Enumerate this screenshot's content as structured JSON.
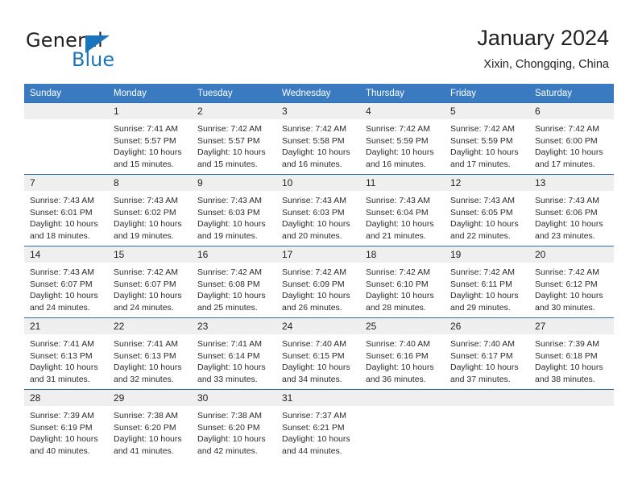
{
  "brand": {
    "name_top": "General",
    "name_bottom": "Blue",
    "accent_color": "#1b75bc"
  },
  "header": {
    "title": "January 2024",
    "subtitle": "Xixin, Chongqing, China"
  },
  "colors": {
    "header_row_bg": "#3a7ac0",
    "header_row_text": "#ffffff",
    "daynum_bg": "#efefef",
    "row_divider": "#2e6da8",
    "cell_bg": "#ffffff"
  },
  "calendar": {
    "weekday_headers": [
      "Sunday",
      "Monday",
      "Tuesday",
      "Wednesday",
      "Thursday",
      "Friday",
      "Saturday"
    ],
    "labels": {
      "sunrise_prefix": "Sunrise:",
      "sunset_prefix": "Sunset:",
      "daylight_prefix": "Daylight:"
    },
    "weeks": [
      [
        {
          "day": "",
          "lines": [
            "",
            "",
            "",
            ""
          ]
        },
        {
          "day": "1",
          "lines": [
            "Sunrise: 7:41 AM",
            "Sunset: 5:57 PM",
            "Daylight: 10 hours",
            "and 15 minutes."
          ]
        },
        {
          "day": "2",
          "lines": [
            "Sunrise: 7:42 AM",
            "Sunset: 5:57 PM",
            "Daylight: 10 hours",
            "and 15 minutes."
          ]
        },
        {
          "day": "3",
          "lines": [
            "Sunrise: 7:42 AM",
            "Sunset: 5:58 PM",
            "Daylight: 10 hours",
            "and 16 minutes."
          ]
        },
        {
          "day": "4",
          "lines": [
            "Sunrise: 7:42 AM",
            "Sunset: 5:59 PM",
            "Daylight: 10 hours",
            "and 16 minutes."
          ]
        },
        {
          "day": "5",
          "lines": [
            "Sunrise: 7:42 AM",
            "Sunset: 5:59 PM",
            "Daylight: 10 hours",
            "and 17 minutes."
          ]
        },
        {
          "day": "6",
          "lines": [
            "Sunrise: 7:42 AM",
            "Sunset: 6:00 PM",
            "Daylight: 10 hours",
            "and 17 minutes."
          ]
        }
      ],
      [
        {
          "day": "7",
          "lines": [
            "Sunrise: 7:43 AM",
            "Sunset: 6:01 PM",
            "Daylight: 10 hours",
            "and 18 minutes."
          ]
        },
        {
          "day": "8",
          "lines": [
            "Sunrise: 7:43 AM",
            "Sunset: 6:02 PM",
            "Daylight: 10 hours",
            "and 19 minutes."
          ]
        },
        {
          "day": "9",
          "lines": [
            "Sunrise: 7:43 AM",
            "Sunset: 6:03 PM",
            "Daylight: 10 hours",
            "and 19 minutes."
          ]
        },
        {
          "day": "10",
          "lines": [
            "Sunrise: 7:43 AM",
            "Sunset: 6:03 PM",
            "Daylight: 10 hours",
            "and 20 minutes."
          ]
        },
        {
          "day": "11",
          "lines": [
            "Sunrise: 7:43 AM",
            "Sunset: 6:04 PM",
            "Daylight: 10 hours",
            "and 21 minutes."
          ]
        },
        {
          "day": "12",
          "lines": [
            "Sunrise: 7:43 AM",
            "Sunset: 6:05 PM",
            "Daylight: 10 hours",
            "and 22 minutes."
          ]
        },
        {
          "day": "13",
          "lines": [
            "Sunrise: 7:43 AM",
            "Sunset: 6:06 PM",
            "Daylight: 10 hours",
            "and 23 minutes."
          ]
        }
      ],
      [
        {
          "day": "14",
          "lines": [
            "Sunrise: 7:43 AM",
            "Sunset: 6:07 PM",
            "Daylight: 10 hours",
            "and 24 minutes."
          ]
        },
        {
          "day": "15",
          "lines": [
            "Sunrise: 7:42 AM",
            "Sunset: 6:07 PM",
            "Daylight: 10 hours",
            "and 24 minutes."
          ]
        },
        {
          "day": "16",
          "lines": [
            "Sunrise: 7:42 AM",
            "Sunset: 6:08 PM",
            "Daylight: 10 hours",
            "and 25 minutes."
          ]
        },
        {
          "day": "17",
          "lines": [
            "Sunrise: 7:42 AM",
            "Sunset: 6:09 PM",
            "Daylight: 10 hours",
            "and 26 minutes."
          ]
        },
        {
          "day": "18",
          "lines": [
            "Sunrise: 7:42 AM",
            "Sunset: 6:10 PM",
            "Daylight: 10 hours",
            "and 28 minutes."
          ]
        },
        {
          "day": "19",
          "lines": [
            "Sunrise: 7:42 AM",
            "Sunset: 6:11 PM",
            "Daylight: 10 hours",
            "and 29 minutes."
          ]
        },
        {
          "day": "20",
          "lines": [
            "Sunrise: 7:42 AM",
            "Sunset: 6:12 PM",
            "Daylight: 10 hours",
            "and 30 minutes."
          ]
        }
      ],
      [
        {
          "day": "21",
          "lines": [
            "Sunrise: 7:41 AM",
            "Sunset: 6:13 PM",
            "Daylight: 10 hours",
            "and 31 minutes."
          ]
        },
        {
          "day": "22",
          "lines": [
            "Sunrise: 7:41 AM",
            "Sunset: 6:13 PM",
            "Daylight: 10 hours",
            "and 32 minutes."
          ]
        },
        {
          "day": "23",
          "lines": [
            "Sunrise: 7:41 AM",
            "Sunset: 6:14 PM",
            "Daylight: 10 hours",
            "and 33 minutes."
          ]
        },
        {
          "day": "24",
          "lines": [
            "Sunrise: 7:40 AM",
            "Sunset: 6:15 PM",
            "Daylight: 10 hours",
            "and 34 minutes."
          ]
        },
        {
          "day": "25",
          "lines": [
            "Sunrise: 7:40 AM",
            "Sunset: 6:16 PM",
            "Daylight: 10 hours",
            "and 36 minutes."
          ]
        },
        {
          "day": "26",
          "lines": [
            "Sunrise: 7:40 AM",
            "Sunset: 6:17 PM",
            "Daylight: 10 hours",
            "and 37 minutes."
          ]
        },
        {
          "day": "27",
          "lines": [
            "Sunrise: 7:39 AM",
            "Sunset: 6:18 PM",
            "Daylight: 10 hours",
            "and 38 minutes."
          ]
        }
      ],
      [
        {
          "day": "28",
          "lines": [
            "Sunrise: 7:39 AM",
            "Sunset: 6:19 PM",
            "Daylight: 10 hours",
            "and 40 minutes."
          ]
        },
        {
          "day": "29",
          "lines": [
            "Sunrise: 7:38 AM",
            "Sunset: 6:20 PM",
            "Daylight: 10 hours",
            "and 41 minutes."
          ]
        },
        {
          "day": "30",
          "lines": [
            "Sunrise: 7:38 AM",
            "Sunset: 6:20 PM",
            "Daylight: 10 hours",
            "and 42 minutes."
          ]
        },
        {
          "day": "31",
          "lines": [
            "Sunrise: 7:37 AM",
            "Sunset: 6:21 PM",
            "Daylight: 10 hours",
            "and 44 minutes."
          ]
        },
        {
          "day": "",
          "lines": [
            "",
            "",
            "",
            ""
          ]
        },
        {
          "day": "",
          "lines": [
            "",
            "",
            "",
            ""
          ]
        },
        {
          "day": "",
          "lines": [
            "",
            "",
            "",
            ""
          ]
        }
      ]
    ]
  }
}
